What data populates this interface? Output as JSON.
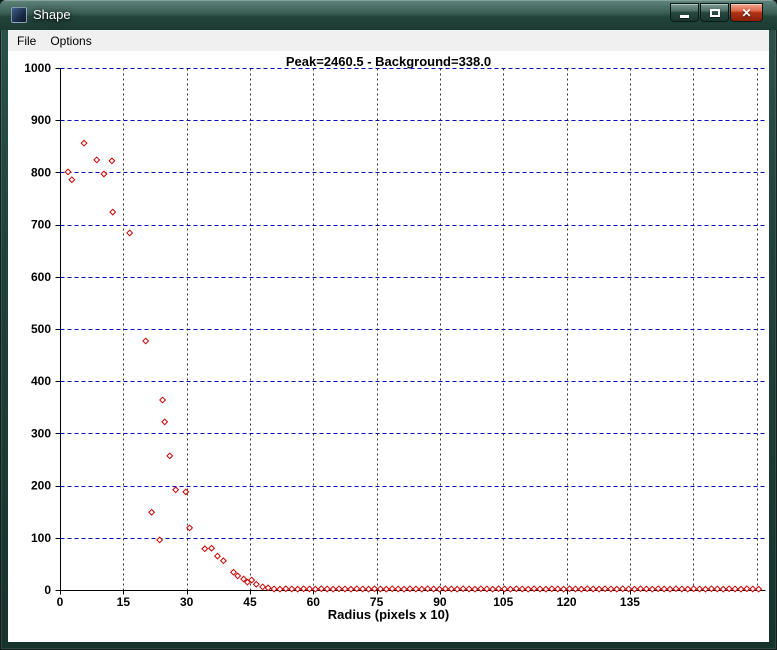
{
  "window": {
    "title": "Shape",
    "controls": [
      {
        "name": "minimize",
        "icon": "minimize-icon"
      },
      {
        "name": "maximize",
        "icon": "maximize-icon"
      },
      {
        "name": "close",
        "icon": "close-icon",
        "glyph": "✕"
      }
    ]
  },
  "menu": {
    "items": [
      {
        "label": "File"
      },
      {
        "label": "Options"
      }
    ]
  },
  "colors": {
    "titlebar": "#2f524a",
    "close_button": "#b23215",
    "menubar_bg": "#f0f0f0",
    "plot_bg": "#ffffff"
  },
  "chart_data": {
    "type": "scatter",
    "title": "Peak=2460.5 - Background=338.0",
    "xlabel": "Radius (pixels x 10)",
    "ylabel": "",
    "xlim": [
      0,
      167
    ],
    "ylim": [
      0,
      1000
    ],
    "xticks": [
      0,
      15,
      30,
      45,
      60,
      75,
      90,
      105,
      120,
      135
    ],
    "xgrid": [
      15,
      30,
      45,
      60,
      75,
      90,
      105,
      120,
      135,
      150,
      165
    ],
    "yticks": [
      0,
      100,
      200,
      300,
      400,
      500,
      600,
      700,
      800,
      900,
      1000
    ],
    "grid": true,
    "grid_h_color": "#0000bb",
    "grid_v_color": "#333333",
    "marker": "open-diamond",
    "marker_color": "#cc0000",
    "points": [
      [
        1.9,
        801
      ],
      [
        2.8,
        786
      ],
      [
        5.7,
        856
      ],
      [
        8.7,
        824
      ],
      [
        10.4,
        797
      ],
      [
        12.3,
        822
      ],
      [
        12.5,
        724
      ],
      [
        16.5,
        684
      ],
      [
        20.3,
        477
      ],
      [
        21.7,
        149
      ],
      [
        23.6,
        96
      ],
      [
        24.3,
        364
      ],
      [
        24.8,
        322
      ],
      [
        26,
        257
      ],
      [
        27.4,
        192
      ],
      [
        29.8,
        188
      ],
      [
        30.7,
        119
      ],
      [
        34.3,
        79
      ],
      [
        35.9,
        80
      ],
      [
        37.3,
        65
      ],
      [
        38.7,
        56
      ],
      [
        41.1,
        34
      ],
      [
        42.1,
        27
      ],
      [
        43.5,
        21
      ],
      [
        44.4,
        15
      ],
      [
        45.4,
        19
      ],
      [
        46.5,
        11
      ],
      [
        48,
        6
      ],
      [
        49.3,
        4
      ],
      [
        50.7,
        2
      ],
      [
        52.1,
        1.6
      ],
      [
        53.5,
        2.4
      ],
      [
        54.9,
        2
      ],
      [
        56.3,
        1.6
      ],
      [
        57.7,
        2.4
      ],
      [
        59.1,
        2
      ],
      [
        60.5,
        1.6
      ],
      [
        61.9,
        2.4
      ],
      [
        63.3,
        2
      ],
      [
        64.7,
        1.6
      ],
      [
        66.1,
        2.4
      ],
      [
        67.5,
        2
      ],
      [
        68.9,
        1.6
      ],
      [
        70.3,
        2.4
      ],
      [
        71.7,
        2
      ],
      [
        73.1,
        1.6
      ],
      [
        74.5,
        2.4
      ],
      [
        75.9,
        2
      ],
      [
        77.3,
        1.6
      ],
      [
        78.7,
        2.4
      ],
      [
        80.1,
        2
      ],
      [
        81.5,
        1.6
      ],
      [
        82.9,
        2.4
      ],
      [
        84.3,
        2
      ],
      [
        85.7,
        1.6
      ],
      [
        87.1,
        2.4
      ],
      [
        88.5,
        2
      ],
      [
        89.9,
        1.6
      ],
      [
        91.3,
        2.4
      ],
      [
        92.7,
        2
      ],
      [
        94.1,
        1.6
      ],
      [
        95.5,
        2.4
      ],
      [
        96.9,
        2
      ],
      [
        98.3,
        1.6
      ],
      [
        99.7,
        2.4
      ],
      [
        101.1,
        2
      ],
      [
        102.5,
        1.6
      ],
      [
        103.9,
        2.4
      ],
      [
        105.3,
        2
      ],
      [
        106.7,
        1.6
      ],
      [
        108.1,
        2.4
      ],
      [
        109.5,
        2
      ],
      [
        110.9,
        1.6
      ],
      [
        112.3,
        2.4
      ],
      [
        113.7,
        2
      ],
      [
        115.1,
        1.6
      ],
      [
        116.5,
        2.4
      ],
      [
        117.9,
        2
      ],
      [
        119.3,
        1.6
      ],
      [
        120.7,
        2.4
      ],
      [
        122.1,
        2
      ],
      [
        123.5,
        1.6
      ],
      [
        124.9,
        2.4
      ],
      [
        126.3,
        2
      ],
      [
        127.7,
        1.6
      ],
      [
        129.1,
        2.4
      ],
      [
        130.5,
        2
      ],
      [
        131.9,
        1.6
      ],
      [
        133.3,
        2.4
      ],
      [
        134.7,
        2
      ],
      [
        136.1,
        1.6
      ],
      [
        137.5,
        2.4
      ],
      [
        138.9,
        2
      ],
      [
        140.3,
        1.6
      ],
      [
        141.7,
        2.4
      ],
      [
        143.1,
        2
      ],
      [
        144.5,
        1.6
      ],
      [
        145.9,
        2.4
      ],
      [
        147.3,
        2
      ],
      [
        148.7,
        1.6
      ],
      [
        150.1,
        2.4
      ],
      [
        151.5,
        2
      ],
      [
        152.9,
        1.6
      ],
      [
        154.3,
        2.4
      ],
      [
        155.7,
        2
      ],
      [
        157.1,
        1.6
      ],
      [
        158.5,
        2.4
      ],
      [
        159.9,
        2
      ],
      [
        161.3,
        1.6
      ],
      [
        162.7,
        2.4
      ],
      [
        164.1,
        2
      ],
      [
        165.5,
        1.6
      ]
    ]
  }
}
